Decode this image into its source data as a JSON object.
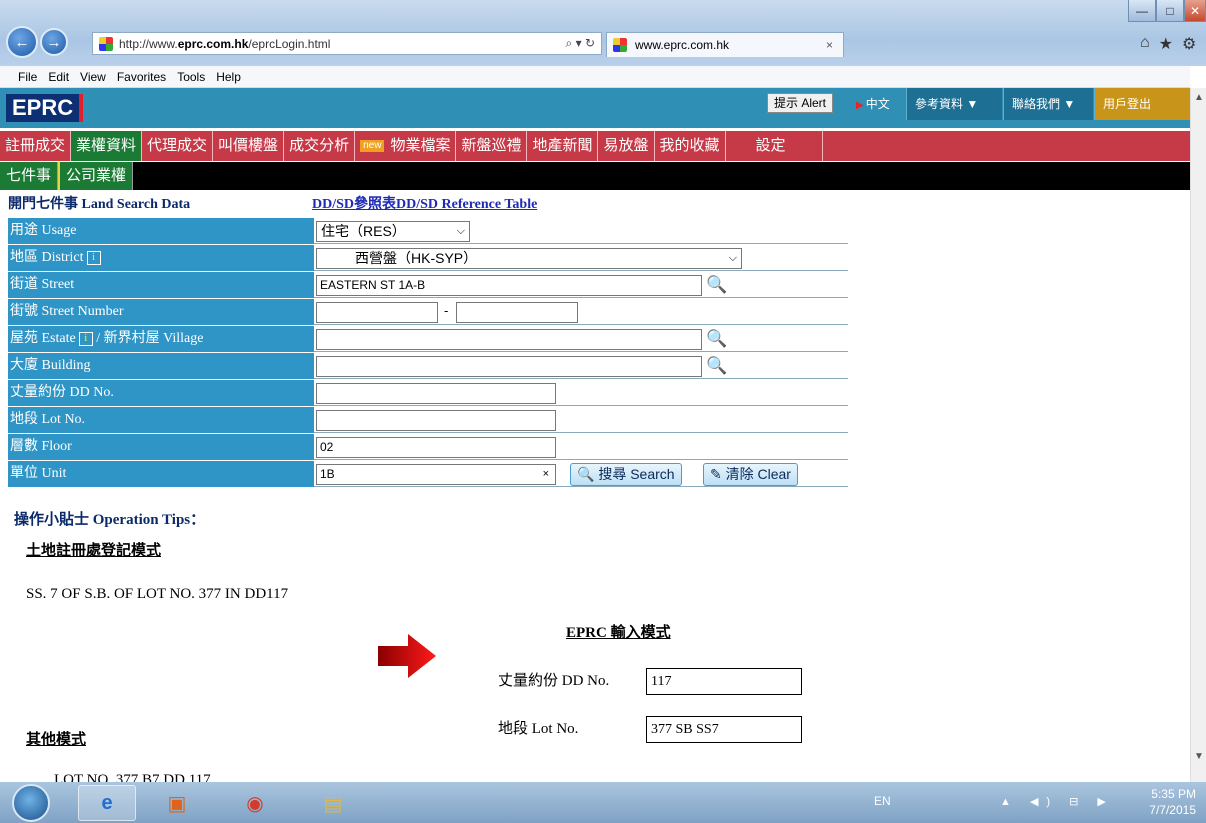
{
  "browser": {
    "url_prefix": "http://www.",
    "url_domain": "eprc.com.hk",
    "url_path": "/eprcLogin.html",
    "addr_tools": "⌕ ▾ ↻",
    "tab_title": "www.eprc.com.hk",
    "tab_close": "×",
    "right_icons": [
      "⌂",
      "★",
      "⚙"
    ]
  },
  "menubar": [
    "File",
    "Edit",
    "View",
    "Favorites",
    "Tools",
    "Help"
  ],
  "header": {
    "logo": "EPRC",
    "alert_button": "提示 Alert",
    "lang_link": "中文",
    "ref_dropdown": "參考資料 ▼",
    "contact_dropdown": "聯絡我們 ▼",
    "logout": "用戶登出"
  },
  "nav_main": [
    {
      "label": "註冊成交",
      "selected": false
    },
    {
      "label": "業權資料",
      "selected": true
    },
    {
      "label": "代理成交",
      "selected": false
    },
    {
      "label": "叫價樓盤",
      "selected": false
    },
    {
      "label": "成交分析",
      "selected": false
    },
    {
      "label": "物業檔案",
      "selected": false,
      "badge": "new"
    },
    {
      "label": "新盤巡禮",
      "selected": false
    },
    {
      "label": "地產新聞",
      "selected": false
    },
    {
      "label": "易放盤",
      "selected": false
    },
    {
      "label": "我的收藏",
      "selected": false
    },
    {
      "label": "設定",
      "selected": false
    }
  ],
  "nav_sub": [
    {
      "label": "七件事",
      "selected": false
    },
    {
      "label": "公司業權",
      "selected": true
    }
  ],
  "form": {
    "title": "開門七件事 Land Search Data",
    "ref_link": "DD/SD參照表DD/SD Reference Table",
    "info_icon": "i",
    "usage_label": "用途 Usage",
    "usage_value": "住宅（RES）",
    "district_label": "地區 District",
    "district_value": "西營盤（HK-SYP）",
    "street_label": "街道 Street",
    "street_value": "EASTERN ST 1A-B",
    "street_no_label": "街號 Street Number",
    "street_no_from": "",
    "street_no_sep": "-",
    "street_no_to": "",
    "estate_label": "屋苑 Estate",
    "estate_label_2": "/ 新界村屋 Village",
    "estate_value": "",
    "building_label": "大廈 Building",
    "building_value": "",
    "dd_label": "丈量約份 DD No.",
    "dd_value": "",
    "lot_label": "地段 Lot No.",
    "lot_value": "",
    "floor_label": "層數 Floor",
    "floor_value": "02",
    "unit_label": "單位 Unit",
    "unit_value": "1B",
    "clear_x": "×",
    "search_button": "搜尋 Search",
    "clear_button": "清除 Clear"
  },
  "tips": {
    "title": "操作小貼士 Operation Tips：",
    "land_mode": "土地註冊處登記模式",
    "example_text": "SS. 7 OF S.B. OF LOT NO. 377 IN DD117",
    "eprc_mode": "EPRC  輸入模式",
    "dd_label": "丈量約份 DD No.",
    "dd_value": "117",
    "lot_label": "地段 Lot No.",
    "lot_value": "377 SB SS7",
    "other_mode": "其他模式",
    "other_example": "LOT NO. 377 B7 DD 117"
  },
  "taskbar": {
    "lang": "EN",
    "tray": "▲ ◀) ⊟ ▶",
    "time": "5:35 PM",
    "date": "7/7/2015"
  },
  "colors": {
    "header_blue": "#2f8fb5",
    "nav_red": "#c63a48",
    "nav_selected_green": "#1b7a33",
    "label_blue": "#2f95c7",
    "logout_gold": "#c9941a"
  }
}
